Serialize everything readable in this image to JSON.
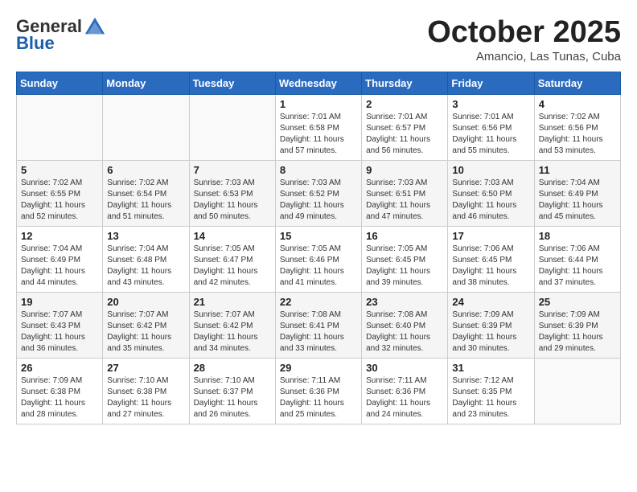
{
  "logo": {
    "general": "General",
    "blue": "Blue"
  },
  "header": {
    "month": "October 2025",
    "location": "Amancio, Las Tunas, Cuba"
  },
  "weekdays": [
    "Sunday",
    "Monday",
    "Tuesday",
    "Wednesday",
    "Thursday",
    "Friday",
    "Saturday"
  ],
  "weeks": [
    [
      {
        "day": "",
        "info": ""
      },
      {
        "day": "",
        "info": ""
      },
      {
        "day": "",
        "info": ""
      },
      {
        "day": "1",
        "info": "Sunrise: 7:01 AM\nSunset: 6:58 PM\nDaylight: 11 hours\nand 57 minutes."
      },
      {
        "day": "2",
        "info": "Sunrise: 7:01 AM\nSunset: 6:57 PM\nDaylight: 11 hours\nand 56 minutes."
      },
      {
        "day": "3",
        "info": "Sunrise: 7:01 AM\nSunset: 6:56 PM\nDaylight: 11 hours\nand 55 minutes."
      },
      {
        "day": "4",
        "info": "Sunrise: 7:02 AM\nSunset: 6:56 PM\nDaylight: 11 hours\nand 53 minutes."
      }
    ],
    [
      {
        "day": "5",
        "info": "Sunrise: 7:02 AM\nSunset: 6:55 PM\nDaylight: 11 hours\nand 52 minutes."
      },
      {
        "day": "6",
        "info": "Sunrise: 7:02 AM\nSunset: 6:54 PM\nDaylight: 11 hours\nand 51 minutes."
      },
      {
        "day": "7",
        "info": "Sunrise: 7:03 AM\nSunset: 6:53 PM\nDaylight: 11 hours\nand 50 minutes."
      },
      {
        "day": "8",
        "info": "Sunrise: 7:03 AM\nSunset: 6:52 PM\nDaylight: 11 hours\nand 49 minutes."
      },
      {
        "day": "9",
        "info": "Sunrise: 7:03 AM\nSunset: 6:51 PM\nDaylight: 11 hours\nand 47 minutes."
      },
      {
        "day": "10",
        "info": "Sunrise: 7:03 AM\nSunset: 6:50 PM\nDaylight: 11 hours\nand 46 minutes."
      },
      {
        "day": "11",
        "info": "Sunrise: 7:04 AM\nSunset: 6:49 PM\nDaylight: 11 hours\nand 45 minutes."
      }
    ],
    [
      {
        "day": "12",
        "info": "Sunrise: 7:04 AM\nSunset: 6:49 PM\nDaylight: 11 hours\nand 44 minutes."
      },
      {
        "day": "13",
        "info": "Sunrise: 7:04 AM\nSunset: 6:48 PM\nDaylight: 11 hours\nand 43 minutes."
      },
      {
        "day": "14",
        "info": "Sunrise: 7:05 AM\nSunset: 6:47 PM\nDaylight: 11 hours\nand 42 minutes."
      },
      {
        "day": "15",
        "info": "Sunrise: 7:05 AM\nSunset: 6:46 PM\nDaylight: 11 hours\nand 41 minutes."
      },
      {
        "day": "16",
        "info": "Sunrise: 7:05 AM\nSunset: 6:45 PM\nDaylight: 11 hours\nand 39 minutes."
      },
      {
        "day": "17",
        "info": "Sunrise: 7:06 AM\nSunset: 6:45 PM\nDaylight: 11 hours\nand 38 minutes."
      },
      {
        "day": "18",
        "info": "Sunrise: 7:06 AM\nSunset: 6:44 PM\nDaylight: 11 hours\nand 37 minutes."
      }
    ],
    [
      {
        "day": "19",
        "info": "Sunrise: 7:07 AM\nSunset: 6:43 PM\nDaylight: 11 hours\nand 36 minutes."
      },
      {
        "day": "20",
        "info": "Sunrise: 7:07 AM\nSunset: 6:42 PM\nDaylight: 11 hours\nand 35 minutes."
      },
      {
        "day": "21",
        "info": "Sunrise: 7:07 AM\nSunset: 6:42 PM\nDaylight: 11 hours\nand 34 minutes."
      },
      {
        "day": "22",
        "info": "Sunrise: 7:08 AM\nSunset: 6:41 PM\nDaylight: 11 hours\nand 33 minutes."
      },
      {
        "day": "23",
        "info": "Sunrise: 7:08 AM\nSunset: 6:40 PM\nDaylight: 11 hours\nand 32 minutes."
      },
      {
        "day": "24",
        "info": "Sunrise: 7:09 AM\nSunset: 6:39 PM\nDaylight: 11 hours\nand 30 minutes."
      },
      {
        "day": "25",
        "info": "Sunrise: 7:09 AM\nSunset: 6:39 PM\nDaylight: 11 hours\nand 29 minutes."
      }
    ],
    [
      {
        "day": "26",
        "info": "Sunrise: 7:09 AM\nSunset: 6:38 PM\nDaylight: 11 hours\nand 28 minutes."
      },
      {
        "day": "27",
        "info": "Sunrise: 7:10 AM\nSunset: 6:38 PM\nDaylight: 11 hours\nand 27 minutes."
      },
      {
        "day": "28",
        "info": "Sunrise: 7:10 AM\nSunset: 6:37 PM\nDaylight: 11 hours\nand 26 minutes."
      },
      {
        "day": "29",
        "info": "Sunrise: 7:11 AM\nSunset: 6:36 PM\nDaylight: 11 hours\nand 25 minutes."
      },
      {
        "day": "30",
        "info": "Sunrise: 7:11 AM\nSunset: 6:36 PM\nDaylight: 11 hours\nand 24 minutes."
      },
      {
        "day": "31",
        "info": "Sunrise: 7:12 AM\nSunset: 6:35 PM\nDaylight: 11 hours\nand 23 minutes."
      },
      {
        "day": "",
        "info": ""
      }
    ]
  ]
}
